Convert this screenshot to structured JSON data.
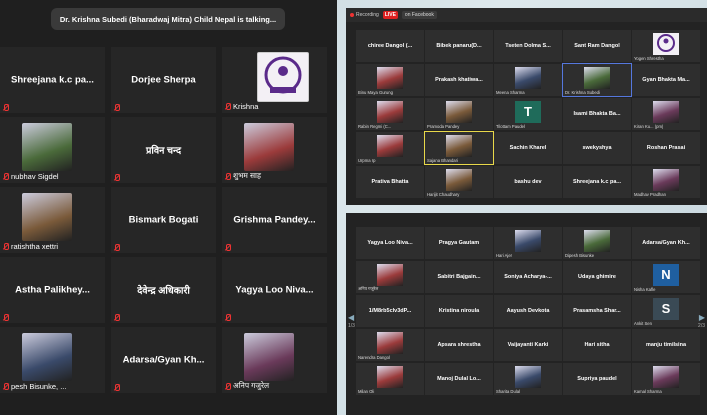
{
  "left": {
    "banner": "Dr. Krishna Subedi (Bharadwaj Mitra) Child Nepal is talking...",
    "tiles": [
      {
        "name": "Shreejana  k.c pa...",
        "label": "",
        "photo": false
      },
      {
        "name": "Dorjee Sherpa",
        "label": "",
        "photo": false
      },
      {
        "name": "",
        "label": "Krishna",
        "photo": true,
        "logo": true
      },
      {
        "name": "",
        "label": "nubhav Sigdel",
        "photo": true
      },
      {
        "name": "प्रविन चन्द",
        "label": "",
        "photo": false
      },
      {
        "name": "",
        "label": "शुभम साह",
        "photo": true
      },
      {
        "name": "",
        "label": "ratishtha xettri",
        "photo": true
      },
      {
        "name": "Bismark Bogati",
        "label": "",
        "photo": false
      },
      {
        "name": "Grishma  Pandey...",
        "label": "",
        "photo": false
      },
      {
        "name": "Astha  Palikhey...",
        "label": "",
        "photo": false
      },
      {
        "name": "देवेन्द्र अधिकारी",
        "label": "",
        "photo": false
      },
      {
        "name": "Yagya Loo Niva...",
        "label": "",
        "photo": false
      },
      {
        "name": "",
        "label": "pesh Bisunke, ...",
        "photo": true
      },
      {
        "name": "Adarsa/Gyan  Kh...",
        "label": "",
        "photo": false
      },
      {
        "name": "",
        "label": "अनिप गजुरेल",
        "photo": true
      }
    ]
  },
  "right_top": {
    "toolbar": {
      "recording": "Recording",
      "live": "LIVE",
      "on": "on Facebook"
    },
    "tiles": [
      {
        "name": "chiree Dangol (...",
        "label": ""
      },
      {
        "name": "Bibek  panaru(D...",
        "label": ""
      },
      {
        "name": "Tseten Dolma S...",
        "label": ""
      },
      {
        "name": "Sant Ram Dangol",
        "label": ""
      },
      {
        "name": "",
        "label": "Yogen Shrestha",
        "img": "logo"
      },
      {
        "name": "",
        "label": "Binu Maya Gurung",
        "img": "person"
      },
      {
        "name": "Prakash  khatiwa...",
        "label": ""
      },
      {
        "name": "",
        "label": "Meena Sharma",
        "img": "person"
      },
      {
        "name": "",
        "label": "Dr. Krishna Subedi",
        "img": "person",
        "speaker": true
      },
      {
        "name": "Gyan Bhakta Ma...",
        "label": ""
      },
      {
        "name": "",
        "label": "Rabin Regmi (C...",
        "img": "person"
      },
      {
        "name": "",
        "label": "Pramoda Pandey",
        "img": "person"
      },
      {
        "name": "",
        "label": "Tilottam Paudel",
        "img": "letterT"
      },
      {
        "name": "Isami Bhakta Ba...",
        "label": ""
      },
      {
        "name": "",
        "label": "Kiran Ku... (pm)",
        "img": "person"
      },
      {
        "name": "",
        "label": "Urpma rp",
        "img": "person"
      },
      {
        "name": "",
        "label": "Sajana Bhandari",
        "img": "person",
        "highlight": true
      },
      {
        "name": "Sachin Kharel",
        "label": ""
      },
      {
        "name": "swekyshya",
        "label": ""
      },
      {
        "name": "Roshan Prasai",
        "label": ""
      },
      {
        "name": "Prativa Bhatta",
        "label": ""
      },
      {
        "name": "",
        "label": "Harijit Chaudhary",
        "img": "person"
      },
      {
        "name": "bashu dev",
        "label": ""
      },
      {
        "name": "Shreejana  k.c pa...",
        "label": ""
      },
      {
        "name": "",
        "label": "Madhav Pradhan",
        "img": "person"
      }
    ]
  },
  "right_bottom": {
    "page_left": "1/3",
    "page_right": "2/3",
    "tiles": [
      {
        "name": "Yagya Loo Niva...",
        "label": ""
      },
      {
        "name": "Pragya Gautam",
        "label": ""
      },
      {
        "name": "",
        "label": "Hari Ajer",
        "img": "person"
      },
      {
        "name": "",
        "label": "Dipesh Bisunke",
        "img": "person"
      },
      {
        "name": "Adarsa/Gyan Kh...",
        "label": ""
      },
      {
        "name": "",
        "label": "अनिप गजुरेल",
        "img": "person"
      },
      {
        "name": "Sabitri  Bajgain...",
        "label": ""
      },
      {
        "name": "Soniya  Acharya-...",
        "label": ""
      },
      {
        "name": "Udaya ghimire",
        "label": ""
      },
      {
        "name": "",
        "label": "Nisha Kafle",
        "img": "letterN"
      },
      {
        "name": "1/M8rb5clv3dP...",
        "label": ""
      },
      {
        "name": "Kristina niroula",
        "label": ""
      },
      {
        "name": "Aayush Devkota",
        "label": ""
      },
      {
        "name": "Prasamsha  Shar...",
        "label": ""
      },
      {
        "name": "",
        "label": "Ankit Sen",
        "img": "letterS"
      },
      {
        "name": "",
        "label": "Narendra Dangol",
        "img": "person"
      },
      {
        "name": "Apsara shrestha",
        "label": ""
      },
      {
        "name": "Vaijayanti Karki",
        "label": ""
      },
      {
        "name": "Hari sitha",
        "label": ""
      },
      {
        "name": "manju timilsina",
        "label": ""
      },
      {
        "name": "",
        "label": "Milan Oli",
        "img": "person"
      },
      {
        "name": "Manoj Dulal Lo...",
        "label": ""
      },
      {
        "name": "",
        "label": "Sharita Dulal",
        "img": "person"
      },
      {
        "name": "Supriya paudel",
        "label": ""
      },
      {
        "name": "",
        "label": "Kamal Sharma",
        "img": "person"
      }
    ]
  }
}
